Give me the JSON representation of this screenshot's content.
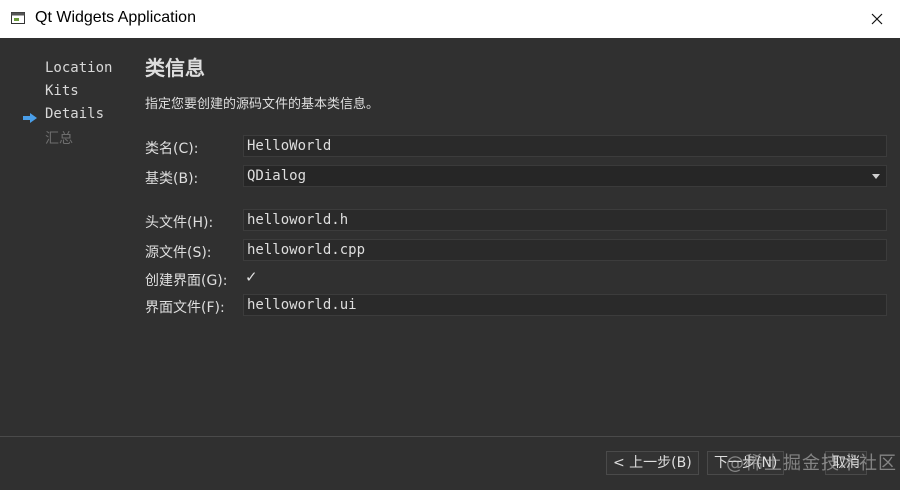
{
  "window": {
    "title": "Qt Widgets Application"
  },
  "sidebar": {
    "items": [
      {
        "label": "Location",
        "state": "done"
      },
      {
        "label": "Kits",
        "state": "done"
      },
      {
        "label": "Details",
        "state": "current"
      },
      {
        "label": "汇总",
        "state": "pending"
      }
    ]
  },
  "main": {
    "title": "类信息",
    "description": "指定您要创建的源码文件的基本类信息。",
    "fields": {
      "class_name": {
        "label": "类名(C):",
        "value": "HelloWorld"
      },
      "base_class": {
        "label": "基类(B):",
        "value": "QDialog"
      },
      "header_file": {
        "label": "头文件(H):",
        "value": "helloworld.h"
      },
      "source_file": {
        "label": "源文件(S):",
        "value": "helloworld.cpp"
      },
      "generate_form": {
        "label": "创建界面(G):",
        "checked": true
      },
      "form_file": {
        "label": "界面文件(F):",
        "value": "helloworld.ui"
      }
    }
  },
  "footer": {
    "back_label": "< 上一步(B)",
    "next_label": "下一步(N)",
    "cancel_label": "取消",
    "watermark": "@稀土掘金技术社区"
  },
  "colors": {
    "accent": "#4a9ee8",
    "background": "#303030",
    "text": "#dedede"
  },
  "icons": {
    "current_step": "arrow-right-icon",
    "window": "app-window-icon",
    "close": "close-icon"
  }
}
